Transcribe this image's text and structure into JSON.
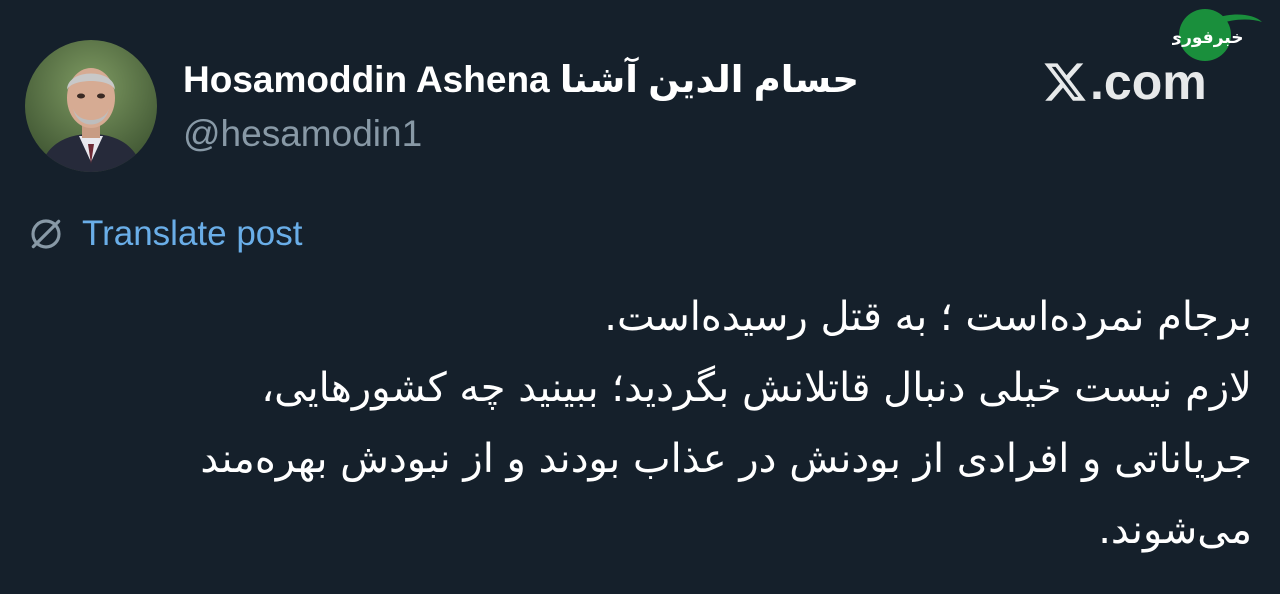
{
  "author": {
    "display_name": "Hosamoddin Ashena حسام الدین آشنا",
    "handle": "@hesamodin1",
    "avatar_icon": "profile-photo"
  },
  "brand": {
    "x_icon": "x-logo-icon",
    "domain": ".com"
  },
  "watermark": {
    "text": "خبرفوری",
    "color": "#1a8f3c"
  },
  "translate": {
    "icon": "globe-translate-icon",
    "label": "Translate post",
    "color": "#6aaee8"
  },
  "post": {
    "lines": [
      "برجام نمرده‌است ؛ به قتل رسیده‌است.",
      "لازم نیست خیلی دنبال قاتلانش بگردید؛ ببینید چه کشورهایی،",
      "جریاناتی و افرادی از بودنش در عذاب بودند و از نبودش بهره‌مند",
      "می‌شوند."
    ]
  },
  "colors": {
    "background": "#15202b",
    "secondary_text": "#8899a6"
  }
}
